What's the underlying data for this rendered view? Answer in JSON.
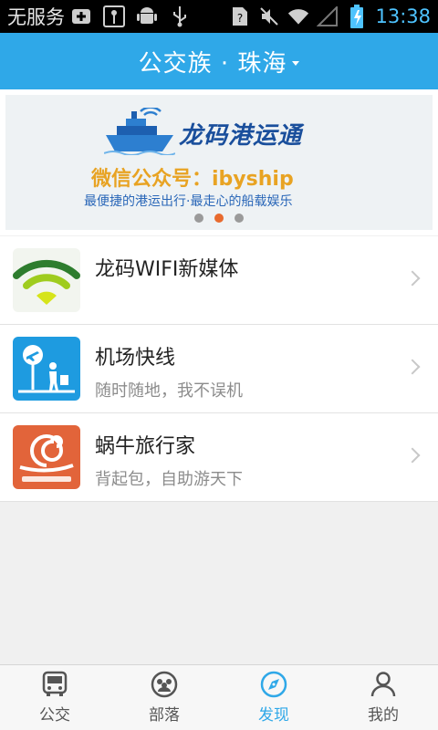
{
  "status_bar": {
    "carrier": "无服务",
    "time": "13:38",
    "icons": [
      "add-box-icon",
      "usb-debug-icon",
      "android-icon",
      "usb-icon",
      "unknown-sim-icon",
      "mute-icon",
      "wifi-icon",
      "no-signal-icon",
      "battery-charging-icon"
    ]
  },
  "header": {
    "title": "公交族 · 珠海"
  },
  "banner": {
    "brand": "龙码港运通",
    "wechat_label": "微信公众号：",
    "wechat_id": "ibyship",
    "slogan": "最便捷的港运出行·最走心的船载娱乐",
    "active_dot": 1,
    "dot_count": 3
  },
  "list": {
    "items": [
      {
        "title": "龙码WIFI新媒体",
        "subtitle": "",
        "icon": "wifi-logo-icon"
      },
      {
        "title": "机场快线",
        "subtitle": "随时随地，我不误机",
        "icon": "airport-express-icon"
      },
      {
        "title": "蜗牛旅行家",
        "subtitle": "背起包，自助游天下",
        "icon": "snail-travel-icon"
      }
    ]
  },
  "bottom_nav": {
    "active": 2,
    "items": [
      {
        "label": "公交",
        "icon": "bus-icon"
      },
      {
        "label": "部落",
        "icon": "tribe-icon"
      },
      {
        "label": "发现",
        "icon": "compass-icon"
      },
      {
        "label": "我的",
        "icon": "person-icon"
      }
    ]
  },
  "colors": {
    "accent": "#2fa8e8",
    "orange": "#e86a2e",
    "status_time": "#4ec3ff"
  }
}
